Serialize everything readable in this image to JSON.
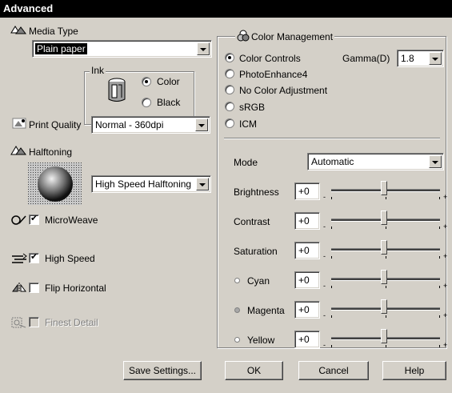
{
  "window": {
    "title": "Advanced"
  },
  "left": {
    "media_type": {
      "label": "Media Type",
      "value": "Plain paper"
    },
    "ink": {
      "label": "Ink",
      "options": [
        {
          "label": "Color",
          "selected": true
        },
        {
          "label": "Black",
          "selected": false
        }
      ]
    },
    "print_quality": {
      "label": "Print Quality",
      "value": "Normal - 360dpi"
    },
    "halftoning": {
      "label": "Halftoning",
      "value": "High Speed Halftoning"
    },
    "microweave": {
      "label": "MicroWeave",
      "checked": true
    },
    "high_speed": {
      "label": "High Speed",
      "checked": true
    },
    "flip_horizontal": {
      "label": "Flip Horizontal",
      "checked": false
    },
    "finest_detail": {
      "label": "Finest Detail",
      "checked": false,
      "enabled": false
    }
  },
  "color_management": {
    "label": "Color Management",
    "options": [
      {
        "label": "Color Controls",
        "selected": true
      },
      {
        "label": "PhotoEnhance4",
        "selected": false
      },
      {
        "label": "No Color Adjustment",
        "selected": false
      },
      {
        "label": "sRGB",
        "selected": false
      },
      {
        "label": "ICM",
        "selected": false
      }
    ],
    "gamma": {
      "label": "Gamma(D)",
      "value": "1.8"
    },
    "mode": {
      "label": "Mode",
      "value": "Automatic"
    },
    "sliders": [
      {
        "label": "Brightness",
        "value": "+0",
        "level": 0
      },
      {
        "label": "Contrast",
        "value": "+0",
        "level": 0
      },
      {
        "label": "Saturation",
        "value": "+0",
        "level": 0
      },
      {
        "label": "Cyan",
        "value": "+0",
        "level": 0,
        "dot_color": "#ffffff"
      },
      {
        "label": "Magenta",
        "value": "+0",
        "level": 0,
        "dot_color": "#a8a8a8"
      },
      {
        "label": "Yellow",
        "value": "+0",
        "level": 0,
        "dot_color": "#ffffff"
      }
    ],
    "scale_minus": "-",
    "scale_plus": "+"
  },
  "buttons": {
    "save_settings": "Save Settings...",
    "ok": "OK",
    "cancel": "Cancel",
    "help": "Help"
  },
  "icons": {
    "media_type": "media-type-icon",
    "ink": "ink-cartridge-icon",
    "print_quality": "print-quality-icon",
    "halftoning": "halftoning-icon",
    "color_management": "color-management-icon",
    "microweave": "microweave-icon",
    "high_speed": "high-speed-icon",
    "flip_horizontal": "flip-horizontal-icon",
    "finest_detail": "finest-detail-icon"
  }
}
